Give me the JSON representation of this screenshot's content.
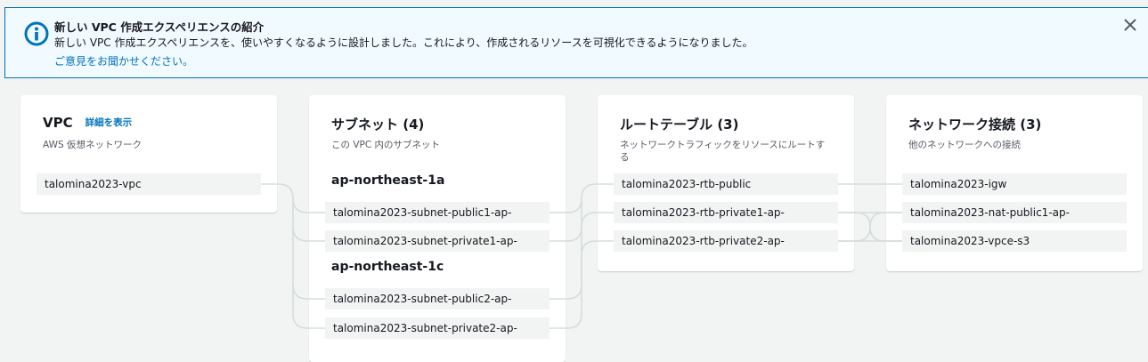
{
  "flash": {
    "title": "新しい VPC 作成エクスペリエンスの紹介",
    "message": "新しい VPC 作成エクスペリエンスを、使いやすくなるように設計しました。これにより、作成されるリソースを可視化できるようになりました。",
    "link": "ご意見をお聞かせください。",
    "icon": "info-icon",
    "close_icon": "close-icon"
  },
  "vpc": {
    "title": "VPC",
    "detail_link": "詳細を表示",
    "description": "AWS 仮想ネットワーク",
    "items": [
      "talomina2023-vpc"
    ]
  },
  "subnets": {
    "title": "サブネット (4)",
    "description": "この VPC 内のサブネット",
    "zones": [
      {
        "name": "ap-northeast-1a",
        "items": [
          "talomina2023-subnet-public1-ap-",
          "talomina2023-subnet-private1-ap-"
        ]
      },
      {
        "name": "ap-northeast-1c",
        "items": [
          "talomina2023-subnet-public2-ap-",
          "talomina2023-subnet-private2-ap-"
        ]
      }
    ]
  },
  "route_tables": {
    "title": "ルートテーブル (3)",
    "description": "ネットワークトラフィックをリソースにルートする",
    "items": [
      "talomina2023-rtb-public",
      "talomina2023-rtb-private1-ap-",
      "talomina2023-rtb-private2-ap-"
    ]
  },
  "network_connections": {
    "title": "ネットワーク接続 (3)",
    "description": "他のネットワークへの接続",
    "items": [
      "talomina2023-igw",
      "talomina2023-nat-public1-ap-",
      "talomina2023-vpce-s3"
    ]
  },
  "colors": {
    "accent": "#0073bb",
    "flash_bg": "#f1faff",
    "connector": "#d5dbdb",
    "resource_bg": "#f2f3f3"
  }
}
